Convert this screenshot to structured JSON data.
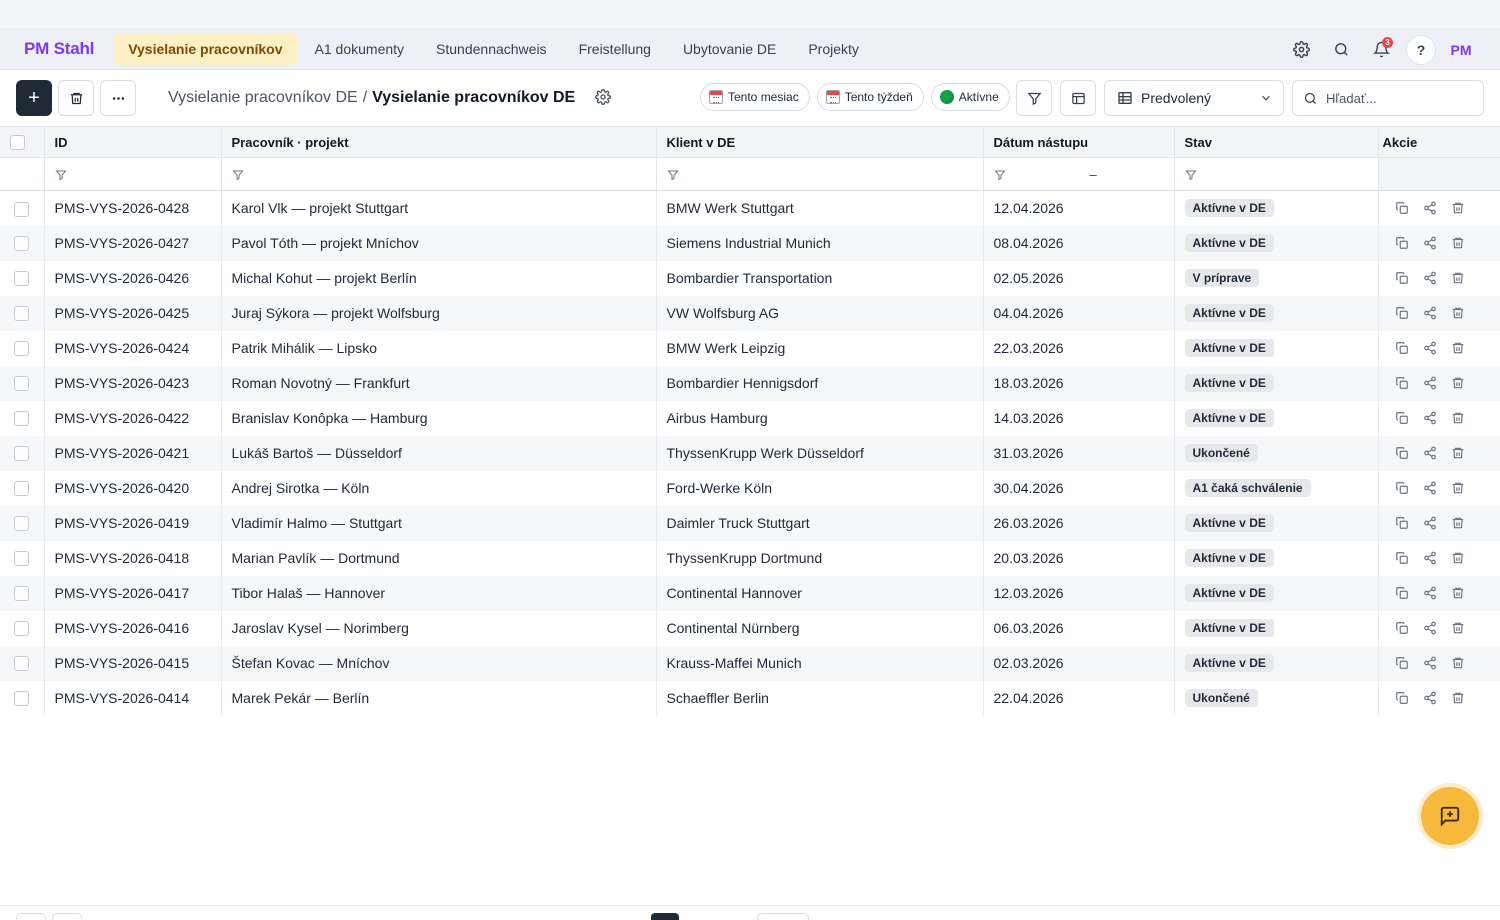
{
  "app": {
    "brand": "PM Stahl"
  },
  "nav": {
    "tabs": [
      {
        "label": "Vysielanie pracovníkov",
        "active": true
      },
      {
        "label": "A1 dokumenty"
      },
      {
        "label": "Stundennachweis"
      },
      {
        "label": "Freistellung"
      },
      {
        "label": "Ubytovanie DE"
      },
      {
        "label": "Projekty"
      }
    ],
    "notifications_count": "3",
    "help_label": "?",
    "user_initials": "PM"
  },
  "toolbar": {
    "add_label": "+",
    "breadcrumb": {
      "parent": "Vysielanie pracovníkov DE",
      "separator": "/",
      "current": "Vysielanie pracovníkov DE"
    },
    "chips": {
      "this_month": "Tento mesiac",
      "this_week": "Tento týždeň",
      "active": "Aktívne"
    },
    "view_select": "Predvolený",
    "search_placeholder": "Hľadať..."
  },
  "table": {
    "columns": {
      "id": "ID",
      "worker": "Pracovník · projekt",
      "client": "Klient v DE",
      "start": "Dátum nástupu",
      "status": "Stav",
      "actions": "Akcie"
    },
    "date_range_dash": "–",
    "rows": [
      {
        "id": "PMS-VYS-2026-0428",
        "worker": "Karol Vlk — projekt Stuttgart",
        "client": "BMW Werk Stuttgart",
        "start": "12.04.2026",
        "status": "Aktívne v DE"
      },
      {
        "id": "PMS-VYS-2026-0427",
        "worker": "Pavol Tóth — projekt Mníchov",
        "client": "Siemens Industrial Munich",
        "start": "08.04.2026",
        "status": "Aktívne v DE"
      },
      {
        "id": "PMS-VYS-2026-0426",
        "worker": "Michal Kohut — projekt Berlín",
        "client": "Bombardier Transportation",
        "start": "02.05.2026",
        "status": "V príprave"
      },
      {
        "id": "PMS-VYS-2026-0425",
        "worker": "Juraj Sýkora — projekt Wolfsburg",
        "client": "VW Wolfsburg AG",
        "start": "04.04.2026",
        "status": "Aktívne v DE"
      },
      {
        "id": "PMS-VYS-2026-0424",
        "worker": "Patrik Mihálik — Lipsko",
        "client": "BMW Werk Leipzig",
        "start": "22.03.2026",
        "status": "Aktívne v DE"
      },
      {
        "id": "PMS-VYS-2026-0423",
        "worker": "Roman Novotný — Frankfurt",
        "client": "Bombardier Hennigsdorf",
        "start": "18.03.2026",
        "status": "Aktívne v DE"
      },
      {
        "id": "PMS-VYS-2026-0422",
        "worker": "Branislav Konôpka — Hamburg",
        "client": "Airbus Hamburg",
        "start": "14.03.2026",
        "status": "Aktívne v DE"
      },
      {
        "id": "PMS-VYS-2026-0421",
        "worker": "Lukáš Bartoš — Düsseldorf",
        "client": "ThyssenKrupp Werk Düsseldorf",
        "start": "31.03.2026",
        "status": "Ukončené"
      },
      {
        "id": "PMS-VYS-2026-0420",
        "worker": "Andrej Sirotka — Köln",
        "client": "Ford-Werke Köln",
        "start": "30.04.2026",
        "status": "A1 čaká schválenie"
      },
      {
        "id": "PMS-VYS-2026-0419",
        "worker": "Vladimír Halmo — Stuttgart",
        "client": "Daimler Truck Stuttgart",
        "start": "26.03.2026",
        "status": "Aktívne v DE"
      },
      {
        "id": "PMS-VYS-2026-0418",
        "worker": "Marian Pavlík — Dortmund",
        "client": "ThyssenKrupp Dortmund",
        "start": "20.03.2026",
        "status": "Aktívne v DE"
      },
      {
        "id": "PMS-VYS-2026-0417",
        "worker": "Tibor Halaš — Hannover",
        "client": "Continental Hannover",
        "start": "12.03.2026",
        "status": "Aktívne v DE"
      },
      {
        "id": "PMS-VYS-2026-0416",
        "worker": "Jaroslav Kysel — Norimberg",
        "client": "Continental Nürnberg",
        "start": "06.03.2026",
        "status": "Aktívne v DE"
      },
      {
        "id": "PMS-VYS-2026-0415",
        "worker": "Štefan Kovac — Mníchov",
        "client": "Krauss-Maffei Munich",
        "start": "02.03.2026",
        "status": "Aktívne v DE"
      },
      {
        "id": "PMS-VYS-2026-0414",
        "worker": "Marek Pekár — Berlín",
        "client": "Schaeffler Berlin",
        "start": "22.04.2026",
        "status": "Ukončené"
      }
    ]
  }
}
